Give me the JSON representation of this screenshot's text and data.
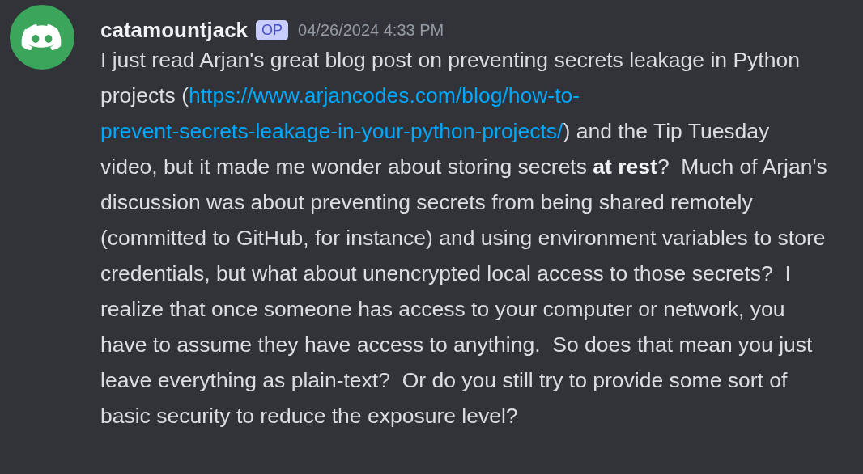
{
  "message": {
    "author": "catamountjack",
    "badge": "OP",
    "timestamp": "04/26/2024 4:33 PM",
    "text_before": "I just read Arjan's great blog post on preventing secrets leakage in Python projects (",
    "link": [
      "https://www.arjancodes.com/blog/how-to-",
      "prevent-secrets-leakage-in-your-python-projects/"
    ],
    "text_after": ") and the Tip Tuesday video, but it made me wonder about storing secrets **at rest**?  Much of Arjan's discussion was about preventing secrets from being shared remotely (committed to GitHub, for instance) and using environment variables to store credentials, but what about unencrypted local access to those secrets?  I realize that once someone has access to your computer or network, you have to assume they have access to anything.  So does that mean you just leave everything as plain-text?  Or do you still try to provide some sort of basic security to reduce the exposure level?"
  }
}
